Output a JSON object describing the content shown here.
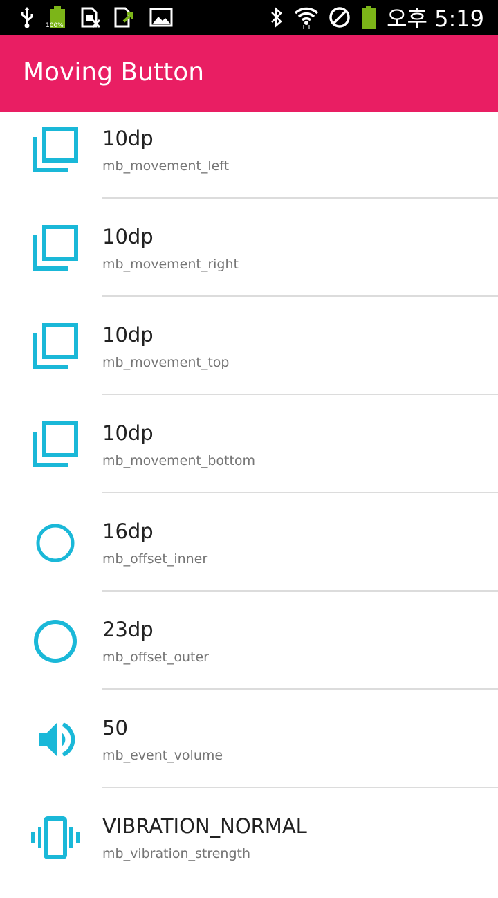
{
  "status_bar": {
    "time": "오후 5:19",
    "battery_small_label": "100%",
    "icons": [
      "usb-icon",
      "battery-full-icon",
      "sim-off-icon",
      "upload-icon",
      "image-icon",
      "bluetooth-icon",
      "wifi-icon",
      "no-sim-icon",
      "battery-icon"
    ]
  },
  "app_bar": {
    "title": "Moving Button",
    "color": "#e91e63"
  },
  "accent_color": "#00bcd4",
  "items": [
    {
      "value": "10dp",
      "key": "mb_movement_left",
      "icon": "copy-icon"
    },
    {
      "value": "10dp",
      "key": "mb_movement_right",
      "icon": "copy-icon"
    },
    {
      "value": "10dp",
      "key": "mb_movement_top",
      "icon": "copy-icon"
    },
    {
      "value": "10dp",
      "key": "mb_movement_bottom",
      "icon": "copy-icon"
    },
    {
      "value": "16dp",
      "key": "mb_offset_inner",
      "icon": "circle-small-icon"
    },
    {
      "value": "23dp",
      "key": "mb_offset_outer",
      "icon": "circle-large-icon"
    },
    {
      "value": "50",
      "key": "mb_event_volume",
      "icon": "volume-icon"
    },
    {
      "value": "VIBRATION_NORMAL",
      "key": "mb_vibration_strength",
      "icon": "vibration-icon"
    }
  ]
}
